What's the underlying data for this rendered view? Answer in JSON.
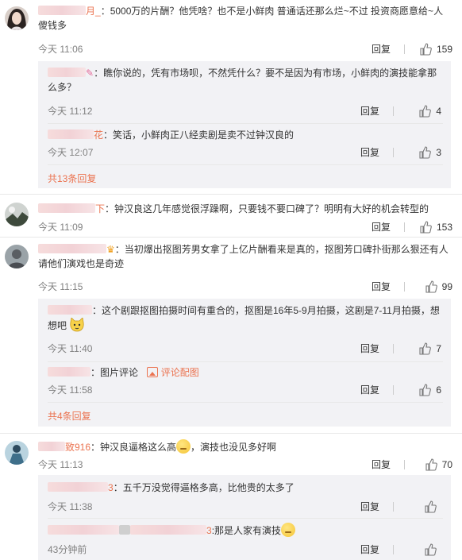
{
  "comments": [
    {
      "name": "月_",
      "text": "：5000万的片酬？他凭啥？也不是小鲜肉 普通话还那么烂~不过 投资商愿意给~人傻钱多",
      "time": "今天 11:06",
      "reply_label": "回复",
      "likes": "159",
      "replies": [
        {
          "name": "",
          "text": "：瞧你说的，凭有市场呗，不然凭什么？要不是因为有市场，小鲜肉的演技能拿那么多？",
          "time": "今天 11:12",
          "reply_label": "回复",
          "likes": "4"
        },
        {
          "name": "花",
          "text": "：笑话，小鲜肉正八经卖剧是卖不过钟汉良的",
          "time": "今天 12:07",
          "reply_label": "回复",
          "likes": "3"
        }
      ],
      "more": "共13条回复"
    },
    {
      "name": "下",
      "text": "：钟汉良这几年感觉很浮躁啊，只要钱不要口碑了？明明有大好的机会转型的",
      "time": "今天 11:09",
      "reply_label": "回复",
      "likes": "153"
    },
    {
      "name": "",
      "text": "：当初爆出抠图芳男女拿了上亿片酬看来是真的，抠图芳口碑扑街那么狠还有人请他们演戏也是奇迹",
      "time": "今天 11:15",
      "reply_label": "回复",
      "likes": "99",
      "replies": [
        {
          "name": "",
          "text": "：这个剧跟抠图拍摄时间有重合的，抠图是16年5-9月拍摄，这剧是7-11月拍摄，想想吧",
          "time": "今天 11:40",
          "reply_label": "回复",
          "likes": "7"
        },
        {
          "name": "",
          "text": "：图片评论",
          "link": "评论配图",
          "time": "今天 11:58",
          "reply_label": "回复",
          "likes": "6"
        }
      ],
      "more": "共4条回复"
    },
    {
      "name": "致916",
      "text_a": "：钟汉良逼格这么高",
      "text_b": "，演技也没见多好啊",
      "time": "今天 11:13",
      "reply_label": "回复",
      "likes": "70",
      "replies": [
        {
          "name": "3",
          "text": "：五千万没觉得逼格多高，比他贵的太多了",
          "time": "今天 11:38",
          "reply_label": "回复",
          "likes": ""
        },
        {
          "name": "3",
          "text": ":那是人家有演技",
          "time": "43分钟前",
          "reply_label": "回复",
          "likes": ""
        }
      ]
    }
  ]
}
